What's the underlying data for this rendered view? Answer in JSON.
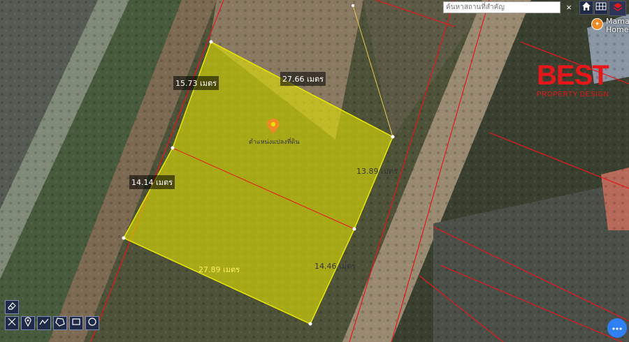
{
  "search": {
    "placeholder": "ค้นหาสถานที่สำคัญ",
    "clear_label": "×"
  },
  "toolbar": {
    "home_icon": "home-icon",
    "grid_icon": "grid-icon",
    "layers_icon": "layers-icon"
  },
  "poi": {
    "name": "Mama Homen",
    "icon": "food-icon"
  },
  "logo": {
    "main": "BEST",
    "sub": "PROPERTY DESIGN"
  },
  "parcel": {
    "pin_label": "ตำแหน่งแปลงที่ดิน",
    "measurements": {
      "top_left": "15.73 เมตร",
      "top": "27.66 เมตร",
      "right_upper": "13.89 เมตร",
      "left_lower": "14.14 เมตร",
      "bottom": "27.89 เมตร",
      "right_lower": "14.46 เมตร"
    }
  },
  "tools": [
    "eraser-icon",
    "measure-icon",
    "marker-icon",
    "polyline-icon",
    "polygon-icon",
    "rectangle-icon",
    "circle-icon"
  ],
  "colors": {
    "parcel_fill": "#e5e500",
    "boundary_line": "#e8161b",
    "brand_red": "#e8161b",
    "fab_blue": "#2f7ff5"
  },
  "fab": {
    "icon": "more-icon"
  }
}
